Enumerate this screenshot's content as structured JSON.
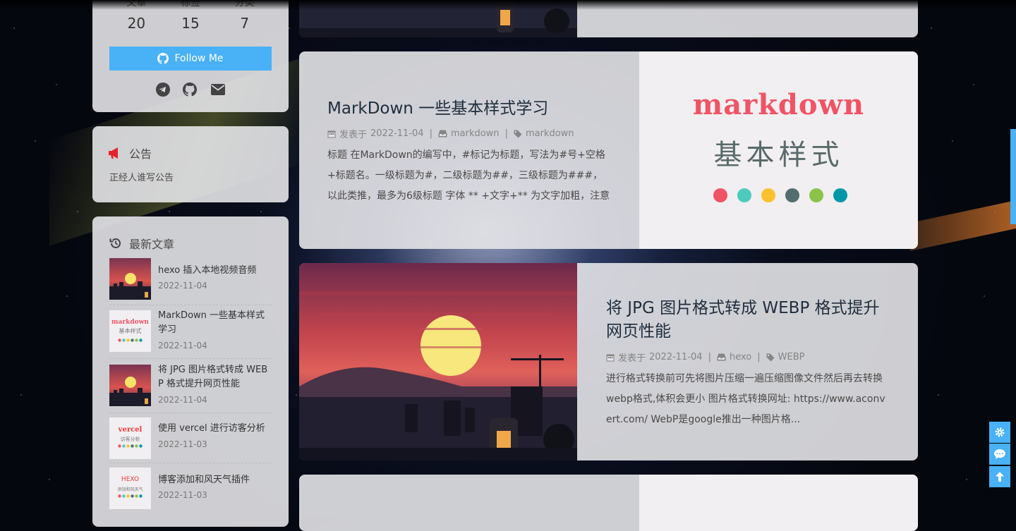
{
  "stats": [
    {
      "label": "文章",
      "value": "20"
    },
    {
      "label": "标签",
      "value": "15"
    },
    {
      "label": "分类",
      "value": "7"
    }
  ],
  "follow_button": "Follow Me",
  "social_icons": [
    "telegram-icon",
    "github-icon",
    "envelope-icon"
  ],
  "announcement": {
    "title": "公告",
    "text": "正经人谁写公告"
  },
  "recent": {
    "title": "最新文章",
    "items": [
      {
        "title": "hexo 插入本地视频音频",
        "date": "2022-11-04",
        "thumb": "sunset"
      },
      {
        "title": "MarkDown 一些基本样式学习",
        "date": "2022-11-04",
        "thumb": "markdown"
      },
      {
        "title": "将 JPG 图片格式转成 WEBP 格式提升网页性能",
        "date": "2022-11-04",
        "thumb": "sunset"
      },
      {
        "title": "使用 vercel 进行访客分析",
        "date": "2022-11-03",
        "thumb": "vercel"
      },
      {
        "title": "博客添加和风天气插件",
        "date": "2022-11-03",
        "thumb": "hexo"
      }
    ],
    "thumb_text": {
      "markdown": "markdown",
      "markdown_sub": "基本样式",
      "vercel": "vercel",
      "vercel_sub": "访客分析",
      "hexo": "HEXO",
      "hexo_sub": "添加和风天气"
    }
  },
  "posts": [
    {
      "title": "MarkDown 一些基本样式学习",
      "meta_prefix": "发表于",
      "date": "2022-11-04",
      "category": "markdown",
      "tag": "markdown",
      "excerpt": "标题 在MarkDown的编写中，#标记为标题，写法为#号+空格+标题名。一级标题为#，二级标题为##，三级标题为###，以此类推，最多为6级标题 字体 ** +文字+** 为文字加粗，注意**与文...",
      "cover_word": "markdown",
      "cover_sub": "基本样式",
      "cover_dot_colors": [
        "#ef5466",
        "#4ecbbd",
        "#fbc02d",
        "#546e6e",
        "#8bc34a",
        "#0097a7"
      ]
    },
    {
      "title": "将 JPG 图片格式转成 WEBP 格式提升网页性能",
      "meta_prefix": "发表于",
      "date": "2022-11-04",
      "category": "hexo",
      "tag": "WEBP",
      "excerpt": "进行格式转换前可先将图片压缩一遍压缩图像文件然后再去转换webp格式,体积会更小 图片格式转换网址: https://www.aconvert.com/ WebP是google推出一种图片格..."
    }
  ],
  "colors": {
    "accent": "#49b1f5",
    "card": "#e4e4e8"
  }
}
